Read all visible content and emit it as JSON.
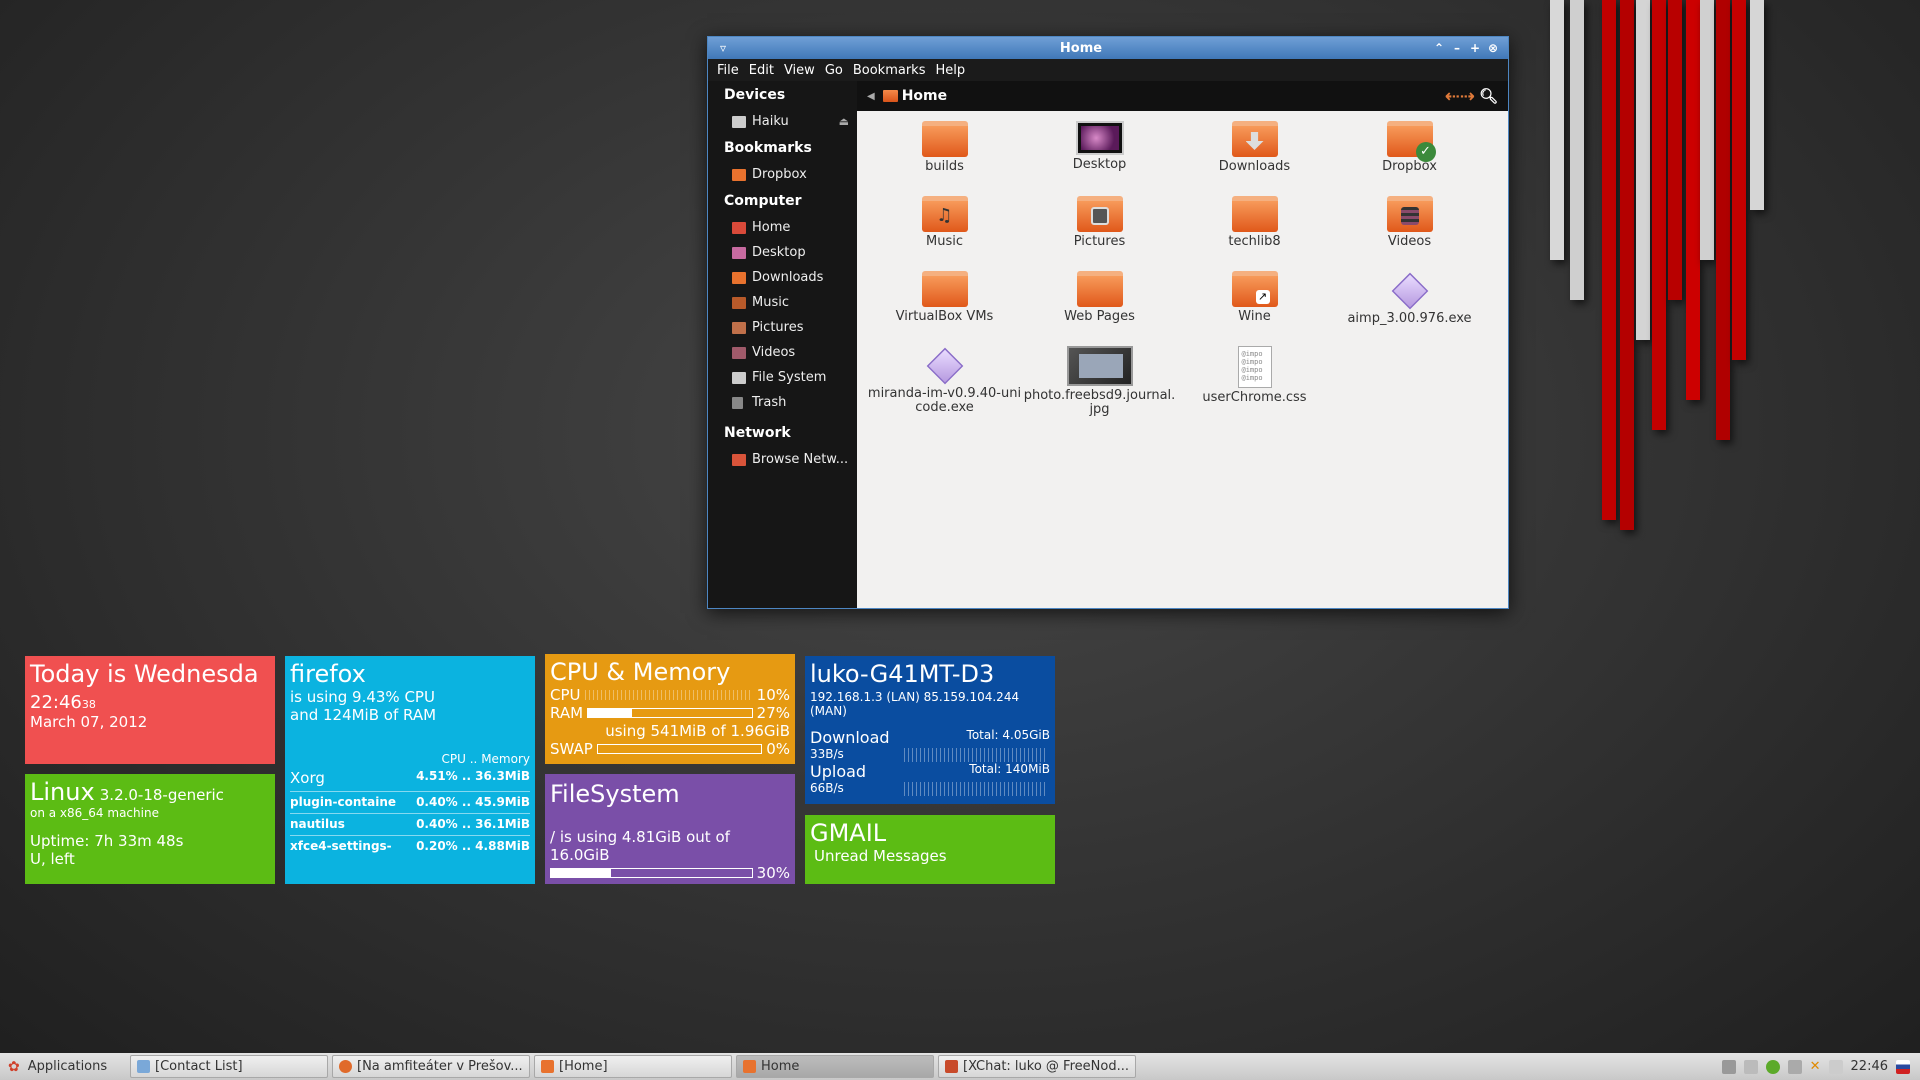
{
  "colors": {
    "tile_red": "#f05050",
    "tile_green": "#5cbc14",
    "tile_cyan": "#0bb3e0",
    "tile_orange": "#e69a12",
    "tile_purple": "#7a4fa8",
    "tile_blue": "#0a4da0",
    "titlebar": "#4a82c2"
  },
  "window": {
    "title": "Home",
    "menu": [
      "File",
      "Edit",
      "View",
      "Go",
      "Bookmarks",
      "Help"
    ],
    "location": "Home",
    "sidebar": {
      "devices_header": "Devices",
      "devices": [
        {
          "label": "Haiku",
          "icon": "drive-icon"
        }
      ],
      "bookmarks_header": "Bookmarks",
      "bookmarks": [
        {
          "label": "Dropbox",
          "icon": "folder-icon"
        }
      ],
      "computer_header": "Computer",
      "computer": [
        {
          "label": "Home",
          "icon": "home-folder-icon"
        },
        {
          "label": "Desktop",
          "icon": "desktop-icon"
        },
        {
          "label": "Downloads",
          "icon": "downloads-folder-icon"
        },
        {
          "label": "Music",
          "icon": "music-folder-icon"
        },
        {
          "label": "Pictures",
          "icon": "pictures-folder-icon"
        },
        {
          "label": "Videos",
          "icon": "videos-folder-icon"
        },
        {
          "label": "File System",
          "icon": "drive-icon"
        },
        {
          "label": "Trash",
          "icon": "trash-icon"
        }
      ],
      "network_header": "Network",
      "network": [
        {
          "label": "Browse Netw...",
          "icon": "network-icon"
        }
      ]
    },
    "files": [
      {
        "name": "builds",
        "type": "folder"
      },
      {
        "name": "Desktop",
        "type": "desktop"
      },
      {
        "name": "Downloads",
        "type": "folder",
        "emblem": "download"
      },
      {
        "name": "Dropbox",
        "type": "folder",
        "emblem": "check"
      },
      {
        "name": "Music",
        "type": "folder",
        "emblem": "music"
      },
      {
        "name": "Pictures",
        "type": "folder",
        "emblem": "pictures"
      },
      {
        "name": "techlib8",
        "type": "folder"
      },
      {
        "name": "Videos",
        "type": "folder",
        "emblem": "videos"
      },
      {
        "name": "VirtualBox VMs",
        "type": "folder"
      },
      {
        "name": "Web Pages",
        "type": "folder"
      },
      {
        "name": "Wine",
        "type": "folder",
        "emblem": "link"
      },
      {
        "name": "aimp_3.00.976.exe",
        "type": "exe"
      },
      {
        "name": "miranda-im-v0.9.40-unicode.exe",
        "type": "exe"
      },
      {
        "name": "photo.freebsd9.journal.jpg",
        "type": "photo"
      },
      {
        "name": "userChrome.css",
        "type": "doc"
      }
    ]
  },
  "tiles": {
    "date": {
      "title": "Today is Wednesda",
      "time": "22:46",
      "seconds": "38",
      "date": "March 07, 2012"
    },
    "linux": {
      "name": "Linux",
      "kernel": "3.2.0-18-generic",
      "machine": "on a x86_64 machine",
      "uptime": "Uptime: 7h 33m 48s",
      "users": "U,  left"
    },
    "firefox": {
      "title": "firefox",
      "line1": "is using  9.43% CPU",
      "line2": "and 124MiB of RAM",
      "col_header": "CPU .. Memory",
      "procs": [
        {
          "name": "Xorg",
          "stats": "4.51% .. 36.3MiB"
        },
        {
          "name": "plugin-containe",
          "stats": "0.40% .. 45.9MiB"
        },
        {
          "name": "nautilus",
          "stats": "0.40% .. 36.1MiB"
        },
        {
          "name": "xfce4-settings-",
          "stats": "0.20% .. 4.88MiB"
        }
      ]
    },
    "cpu": {
      "title": "CPU & Memory",
      "cpu_label": "CPU",
      "cpu_value": "10%",
      "ram_label": "RAM",
      "ram_value": "27%",
      "ram_fill": 0.27,
      "mem_using": "using 541MiB of 1.96GiB",
      "swap_label": "SWAP",
      "swap_value": "0%",
      "swap_fill": 0
    },
    "fs": {
      "title": "FileSystem",
      "usage": "/ is using 4.81GiB out of 16.0GiB",
      "percent": "30%",
      "fill": 0.3
    },
    "net": {
      "host": "luko-G41MT-D3",
      "ips": "192.168.1.3 (LAN) 85.159.104.244 (MAN)",
      "down_label": "Download",
      "down_rate": "33B/s",
      "down_total": "Total: 4.05GiB",
      "up_label": "Upload",
      "up_rate": "66B/s",
      "up_total": "Total: 140MiB"
    },
    "gmail": {
      "title": "GMAIL",
      "subtitle": "Unread Messages"
    }
  },
  "taskbar": {
    "apps_label": "Applications",
    "buttons": [
      {
        "label": "[Contact List]",
        "icon": "contact-list-icon",
        "active": false
      },
      {
        "label": "[Na amfiteáter v Prešov...",
        "icon": "firefox-icon",
        "active": false
      },
      {
        "label": "[Home]",
        "icon": "folder-icon",
        "active": false
      },
      {
        "label": "Home",
        "icon": "folder-icon",
        "active": true
      },
      {
        "label": "[XChat: luko @ FreeNod...",
        "icon": "xchat-icon",
        "active": false
      }
    ],
    "clock": "22:46"
  }
}
